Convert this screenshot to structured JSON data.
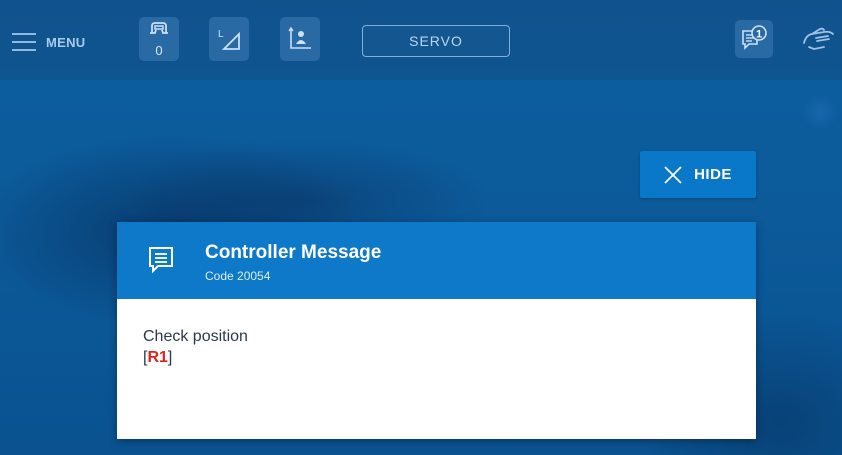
{
  "topbar": {
    "menu_label": "MENU",
    "tool_count": "0",
    "mode_label": "SERVO",
    "icons": [
      "menu-icon",
      "gripper-icon",
      "frame-icon",
      "user-frame-icon",
      "messages-icon",
      "hand-icon"
    ],
    "message_badge": "1"
  },
  "hide_button": {
    "label": "HIDE",
    "icon": "close-icon"
  },
  "dialog": {
    "title": "Controller Message",
    "code": "Code 20054",
    "message": "Check position",
    "robot_open": "[",
    "robot_id": "R1",
    "robot_close": "]",
    "icon": "message-icon"
  },
  "colors": {
    "header_blue": "#0d79c8",
    "button_blue": "#0a78c8",
    "robot_red": "#e3231b"
  }
}
